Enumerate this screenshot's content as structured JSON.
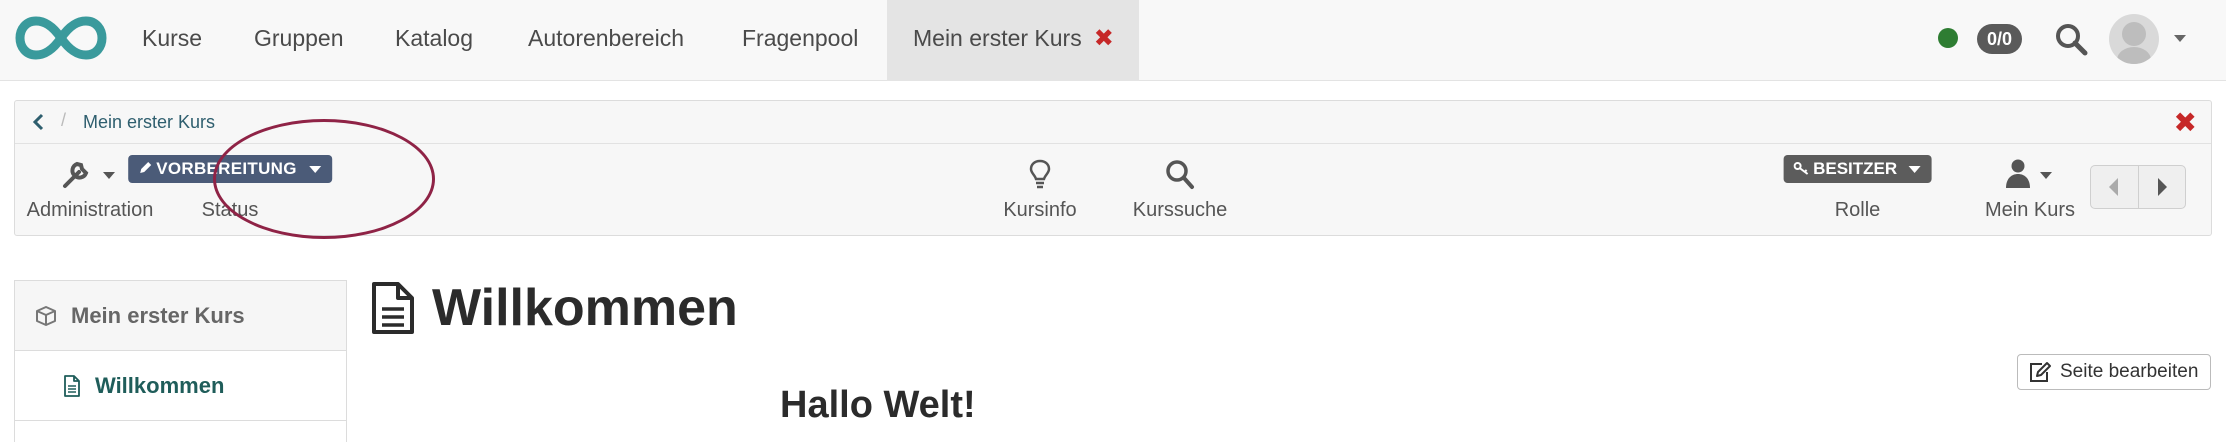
{
  "topnav": {
    "items": [
      {
        "label": "Kurse"
      },
      {
        "label": "Gruppen"
      },
      {
        "label": "Katalog"
      },
      {
        "label": "Autorenbereich"
      },
      {
        "label": "Fragenpool"
      }
    ],
    "active_tab": {
      "label": "Mein erster Kurs",
      "close_glyph": "✖"
    },
    "counter": "0/0",
    "colors": {
      "status_dot": "#2e7d32",
      "accent": "#3a9a9c",
      "close": "#c62828"
    }
  },
  "breadcrumb": {
    "current": "Mein erster Kurs",
    "separator": "/",
    "close_glyph": "✖"
  },
  "toolbar": {
    "administration": {
      "label": "Administration",
      "icon": "wrench-icon"
    },
    "status": {
      "badge": "VORBEREITUNG",
      "label": "Status",
      "icon": "pencil-icon"
    },
    "kursinfo": {
      "label": "Kursinfo",
      "icon": "lightbulb-icon"
    },
    "kurssuche": {
      "label": "Kurssuche",
      "icon": "search-icon"
    },
    "rolle": {
      "badge": "BESITZER",
      "label": "Rolle",
      "icon": "key-icon"
    },
    "mein_kurs": {
      "label": "Mein Kurs",
      "icon": "user-icon"
    }
  },
  "sidebar": {
    "root": {
      "label": "Mein erster Kurs",
      "icon": "cube-icon"
    },
    "items": [
      {
        "label": "Willkommen",
        "icon": "file-icon"
      }
    ]
  },
  "main": {
    "title": "Willkommen",
    "edit_button": "Seite bearbeiten",
    "heading": "Hallo Welt!"
  }
}
